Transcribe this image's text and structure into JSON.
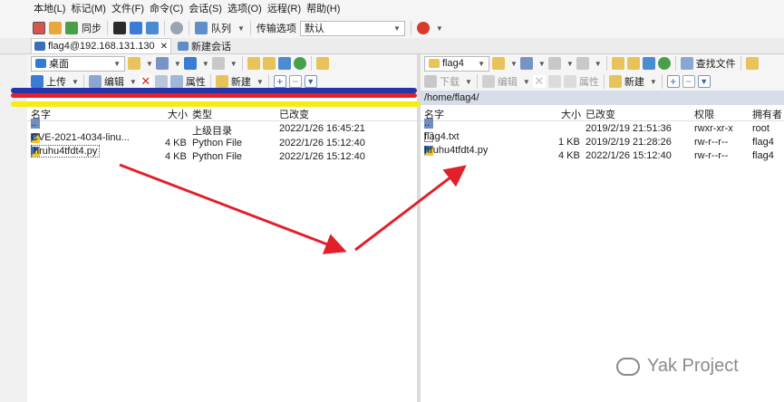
{
  "menubar": [
    "本地(L)",
    "标记(M)",
    "文件(F)",
    "命令(C)",
    "会话(S)",
    "选项(O)",
    "远程(R)",
    "帮助(H)"
  ],
  "toolbar": {
    "sync_label": "同步",
    "queue_label": "队列",
    "transfer_options_label": "传输选项",
    "transfer_mode_value": "默认"
  },
  "session_tabs": {
    "active": "flag4@192.168.131.130",
    "new_session": "新建会话"
  },
  "left": {
    "location": "桌面",
    "upload_label": "上传",
    "edit_label": "编辑",
    "props_label": "属性",
    "new_label": "新建",
    "columns": {
      "name": "名字",
      "size": "大小",
      "type": "类型",
      "modified": "已改变"
    },
    "files": [
      {
        "name": "..",
        "size": "",
        "type": "上级目录",
        "modified": "2022/1/26  16:45:21"
      },
      {
        "name": "CVE-2021-4034-linu...",
        "size": "4 KB",
        "type": "Python File",
        "modified": "2022/1/26  15:12:40"
      },
      {
        "name": "hruhu4tfdt4.py",
        "size": "4 KB",
        "type": "Python File",
        "modified": "2022/1/26  15:12:40"
      }
    ]
  },
  "right": {
    "location": "flag4",
    "find_label": "查找文件",
    "download_label": "下载",
    "edit_label": "编辑",
    "props_label": "属性",
    "new_label": "新建",
    "path": "/home/flag4/",
    "columns": {
      "name": "名字",
      "size": "大小",
      "modified": "已改变",
      "perms": "权限",
      "owner": "拥有者"
    },
    "files": [
      {
        "name": "..",
        "size": "",
        "modified": "2019/2/19 21:51:36",
        "perms": "rwxr-xr-x",
        "owner": "root"
      },
      {
        "name": "flag4.txt",
        "size": "1 KB",
        "modified": "2019/2/19 21:28:26",
        "perms": "rw-r--r--",
        "owner": "flag4"
      },
      {
        "name": "hruhu4tfdt4.py",
        "size": "4 KB",
        "modified": "2022/1/26 15:12:40",
        "perms": "rw-r--r--",
        "owner": "flag4"
      }
    ]
  },
  "watermark": "Yak Project",
  "colors": {
    "stripe_blue": "#2733a8",
    "stripe_red": "#e2202b",
    "stripe_yellow": "#f6ec14",
    "arrow_red": "#e2202b",
    "path_bar": "#d6dde8"
  }
}
